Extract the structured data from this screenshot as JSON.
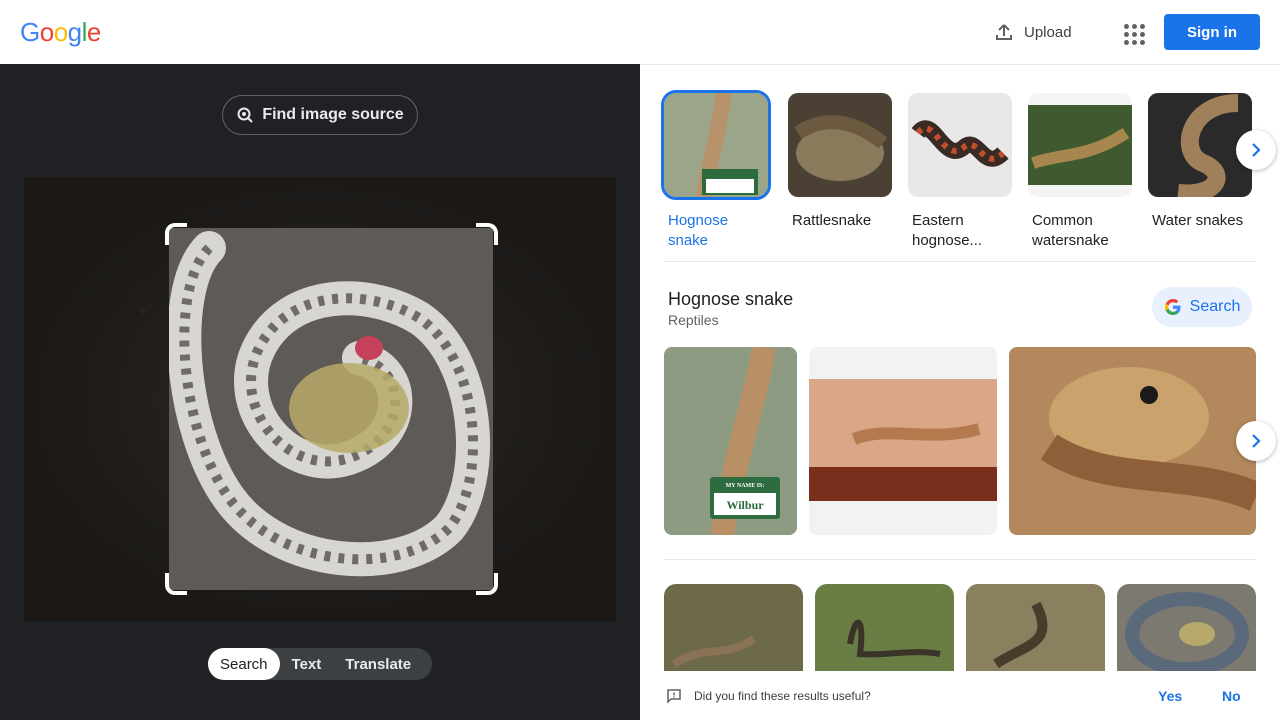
{
  "header": {
    "logo_letters": [
      {
        "ch": "G",
        "color": "#4285F4"
      },
      {
        "ch": "o",
        "color": "#EA4335"
      },
      {
        "ch": "o",
        "color": "#FBBC05"
      },
      {
        "ch": "g",
        "color": "#4285F4"
      },
      {
        "ch": "l",
        "color": "#34A853"
      },
      {
        "ch": "e",
        "color": "#EA4335"
      }
    ],
    "upload_label": "Upload",
    "signin_label": "Sign in",
    "accent": "#1a73e8"
  },
  "left": {
    "find_source_label": "Find image source",
    "modes": [
      {
        "label": "Search",
        "active": true
      },
      {
        "label": "Text",
        "active": false
      },
      {
        "label": "Translate",
        "active": false
      }
    ]
  },
  "related": {
    "items": [
      {
        "label": "Hognose snake",
        "selected": true
      },
      {
        "label": "Rattlesnake",
        "selected": false
      },
      {
        "label": "Eastern hognose...",
        "selected": false
      },
      {
        "label": "Common watersnake",
        "selected": false
      },
      {
        "label": "Water snakes",
        "selected": false
      }
    ]
  },
  "knowledge": {
    "title": "Hognose snake",
    "subtitle": "Reptiles",
    "search_label": "Search",
    "name_tag": {
      "line1": "MY NAME IS:",
      "line2": "Wilbur"
    }
  },
  "feedback": {
    "question": "Did you find these results useful?",
    "yes": "Yes",
    "no": "No"
  }
}
